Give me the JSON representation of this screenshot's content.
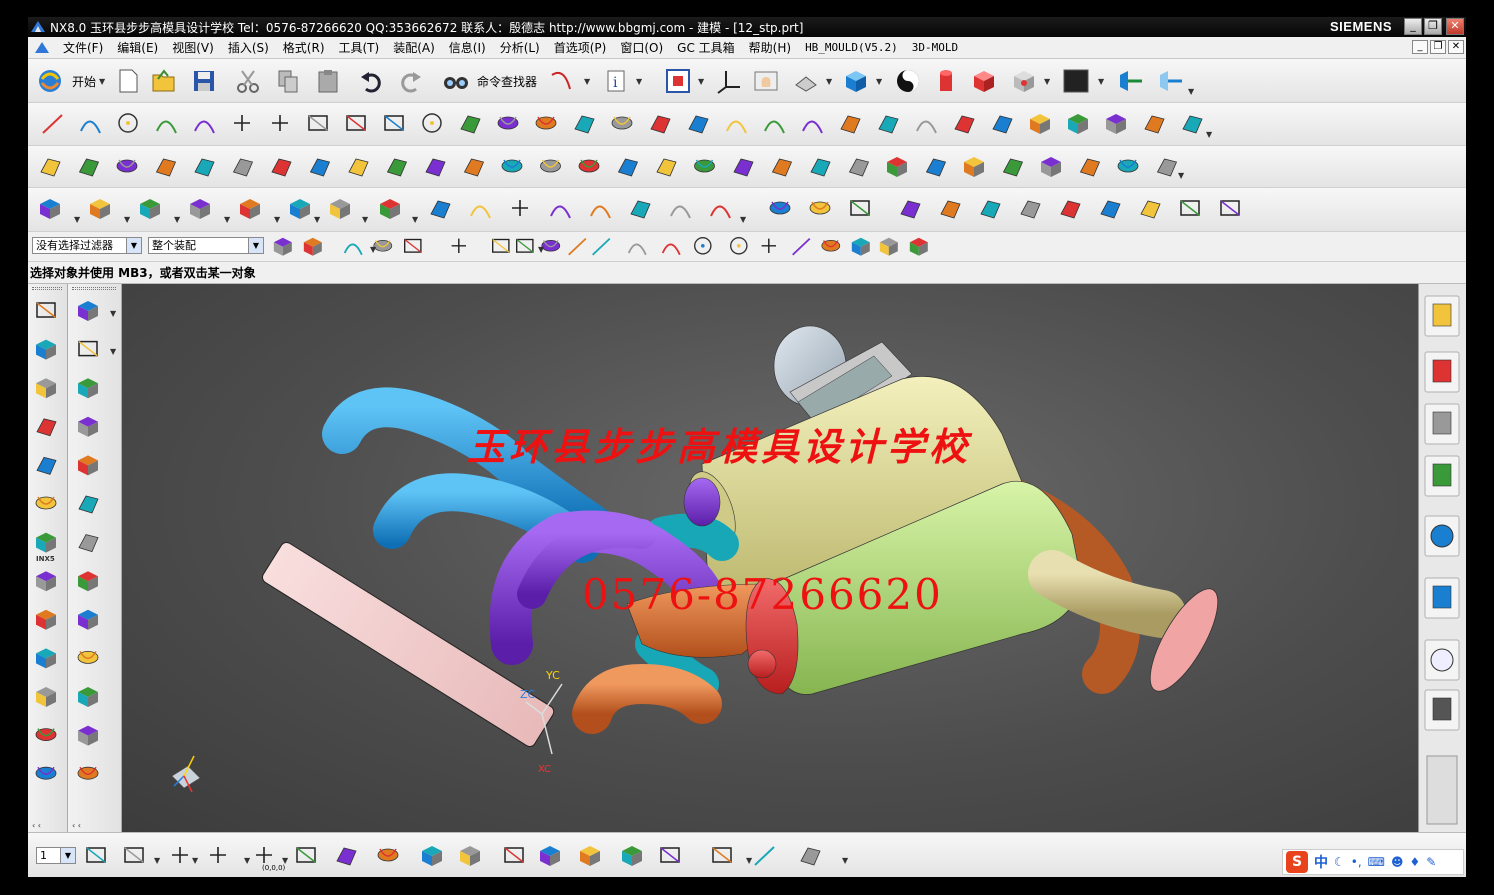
{
  "window": {
    "title": "NX8.0 玉环县步步高模具设计学校  Tel：0576-87266620 QQ:353662672  联系人：殷德志  http://www.bbgmj.com - 建模 - [12_stp.prt]",
    "brand": "SIEMENS",
    "minimize": "_",
    "maximize": "❐",
    "close": "✕"
  },
  "menu": {
    "items": [
      "文件(F)",
      "编辑(E)",
      "视图(V)",
      "插入(S)",
      "格式(R)",
      "工具(T)",
      "装配(A)",
      "信息(I)",
      "分析(L)",
      "首选项(P)",
      "窗口(O)",
      "GC 工具箱",
      "帮助(H)"
    ],
    "mono_items": [
      "HB_MOULD(V5.2)",
      "3D-MOLD"
    ]
  },
  "standard_toolbar": {
    "start_label": "开始",
    "command_finder_label": "命令查找器"
  },
  "selection_bar": {
    "filter_value": "没有选择过滤器",
    "scope_value": "整个装配"
  },
  "cue_line": "选择对象并使用 MB3，或者双击某一对象",
  "graphics": {
    "watermark_school": "玉环县步步高模具设计学校",
    "watermark_phone": "0576-87266620",
    "axis_labels": {
      "yc": "YC",
      "zc": "ZC",
      "xc": "XC"
    }
  },
  "palette_left": {
    "badge": "INX5"
  },
  "bottom_toolbar": {
    "layer_value": "1",
    "origin_label": "(0,0,0)"
  },
  "ime": {
    "logo": "S",
    "lang": "中"
  },
  "colors": {
    "header_left_pipe": "#1b7fc4",
    "purple_pipe": "#7a2fd0",
    "orange_pipe": "#d0672a",
    "cyan_pipe": "#18a8b8",
    "yellow_can": "#e3df95",
    "green_can": "#b7df80",
    "red_band": "#e33636",
    "flange": "#f5d3d3",
    "watermark": "#ee1111"
  }
}
